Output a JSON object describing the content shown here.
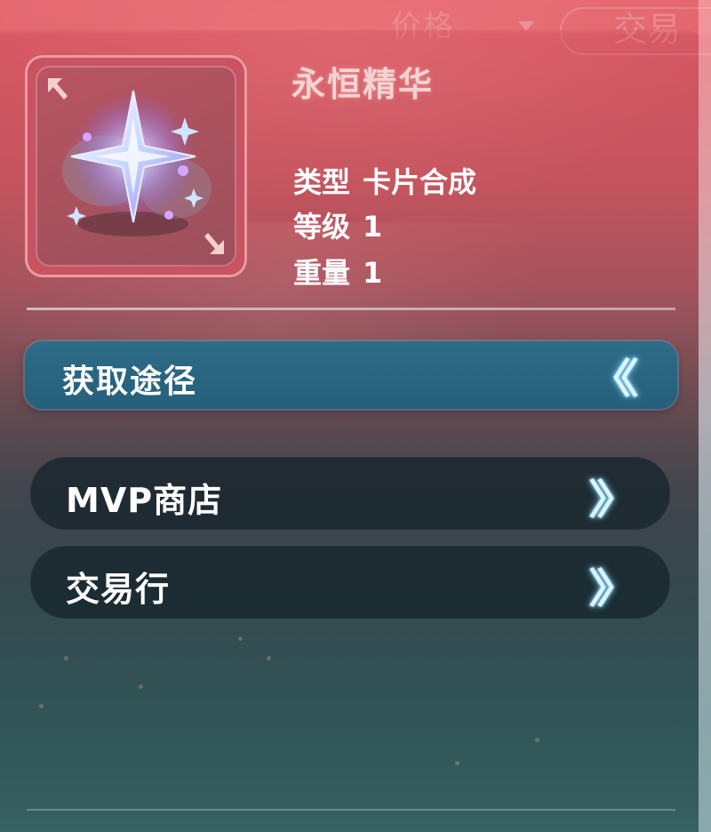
{
  "background": {
    "price_label": "价格",
    "trade_label": "交易"
  },
  "item": {
    "name": "永恒精华",
    "icon": "crystal-star-icon",
    "stats": [
      {
        "label": "类型",
        "value": "卡片合成"
      },
      {
        "label": "等级",
        "value": "1"
      },
      {
        "label": "重量",
        "value": "1"
      }
    ]
  },
  "acquisition": {
    "header_label": "获取途径",
    "header_icon": "double-chevron-left-icon",
    "sources": [
      {
        "label": "MVP商店",
        "icon": "double-chevron-right-icon"
      },
      {
        "label": "交易行",
        "icon": "double-chevron-right-icon"
      }
    ]
  },
  "colors": {
    "header_bg": "#2e6c87",
    "row_bg": "#16242c",
    "name_color": "#f3d3d1",
    "chevron_glow": "#7fd8ff"
  }
}
